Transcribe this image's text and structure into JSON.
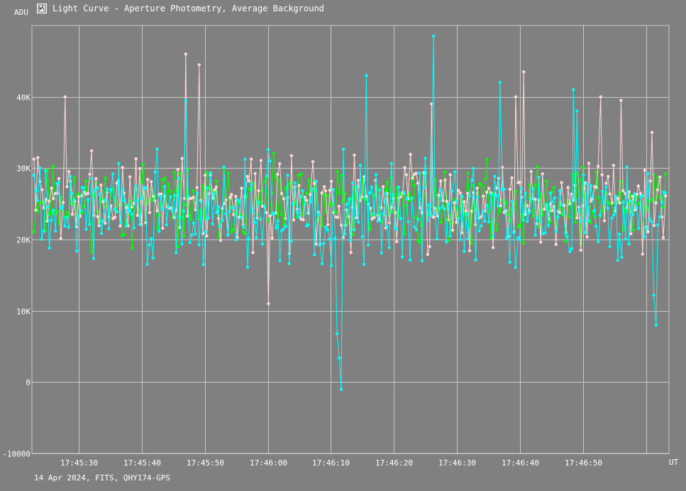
{
  "window": {
    "title": "Light Curve - Aperture Photometry, Average Background",
    "icon": "light-curve-app-icon",
    "footer": "14 Apr 2024, FITS, QHY174-GPS"
  },
  "colors": {
    "background": "#808080",
    "grid": "#c8c8c8",
    "text": "#ffffff"
  },
  "chart_data": {
    "type": "line",
    "ylabel": "ADU",
    "xlabel": "UT",
    "ylim": [
      -10000,
      50000
    ],
    "xlim": [
      22.6,
      123.6
    ],
    "x_ticks": [
      {
        "value": 30,
        "label": "17:45:30"
      },
      {
        "value": 40,
        "label": "17:45:40"
      },
      {
        "value": 50,
        "label": "17:45:50"
      },
      {
        "value": 60,
        "label": "17:46:00"
      },
      {
        "value": 70,
        "label": "17:46:10"
      },
      {
        "value": 80,
        "label": "17:46:20"
      },
      {
        "value": 90,
        "label": "17:46:30"
      },
      {
        "value": 100,
        "label": "17:46:40"
      },
      {
        "value": 110,
        "label": "17:46:50"
      },
      {
        "value": 120,
        "label": ""
      }
    ],
    "y_ticks": [
      {
        "value": 40000,
        "label": "40K"
      },
      {
        "value": 30000,
        "label": "30K"
      },
      {
        "value": 20000,
        "label": "20K"
      },
      {
        "value": 10000,
        "label": "10K"
      },
      {
        "value": 0,
        "label": "0"
      },
      {
        "value": -10000,
        "label": "-10000"
      }
    ],
    "grid": true,
    "series": [
      {
        "color": "#00ff00",
        "seed": 11,
        "count": 330,
        "mean": 25000,
        "spread": 4500,
        "spikes": []
      },
      {
        "color": "#ffd8d8",
        "seed": 7,
        "count": 330,
        "mean": 25500,
        "spread": 5500,
        "spikes": [
          {
            "x": 28.0,
            "y": 40000
          },
          {
            "x": 47.1,
            "y": 46000
          },
          {
            "x": 49.0,
            "y": 44500
          },
          {
            "x": 60.0,
            "y": 11000
          },
          {
            "x": 86.0,
            "y": 39000
          },
          {
            "x": 99.2,
            "y": 40000
          },
          {
            "x": 100.6,
            "y": 43500
          },
          {
            "x": 112.6,
            "y": 40000
          },
          {
            "x": 116.0,
            "y": 39500
          },
          {
            "x": 121.0,
            "y": 35000
          }
        ]
      },
      {
        "color": "#00ffff",
        "seed": 3,
        "count": 330,
        "mean": 24000,
        "spread": 6500,
        "spikes": [
          {
            "x": 47.0,
            "y": 39500
          },
          {
            "x": 71.0,
            "y": 6800
          },
          {
            "x": 71.4,
            "y": 3400
          },
          {
            "x": 71.6,
            "y": -1000
          },
          {
            "x": 75.5,
            "y": 43000
          },
          {
            "x": 86.3,
            "y": 48500
          },
          {
            "x": 97.0,
            "y": 42000
          },
          {
            "x": 108.5,
            "y": 41000
          },
          {
            "x": 109.0,
            "y": 38000
          },
          {
            "x": 121.5,
            "y": 8000
          },
          {
            "x": 121.2,
            "y": 12200
          }
        ]
      }
    ]
  }
}
